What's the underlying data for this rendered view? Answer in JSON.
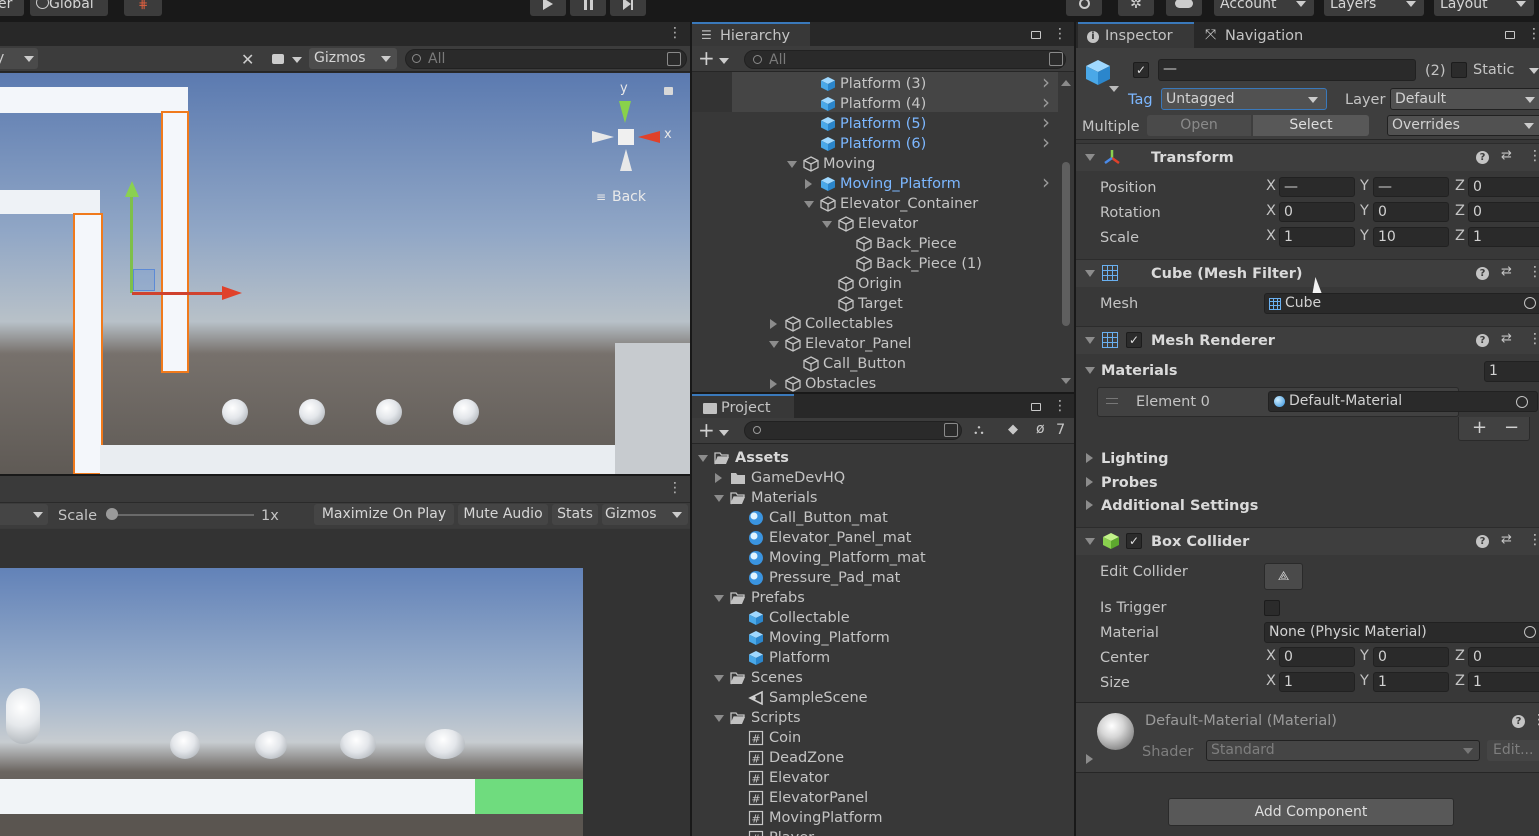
{
  "toolbar": {
    "left_label": "er",
    "global_label": "Global",
    "account": "Account",
    "layers": "Layers",
    "layout": "Layout"
  },
  "scene": {
    "gizmos": "Gizmos",
    "search_placeholder": "All",
    "back_label": "Back",
    "axis_y": "y",
    "axis_x": "x"
  },
  "game": {
    "scale_label": "Scale",
    "scale_value": "1x",
    "maximize": "Maximize On Play",
    "mute": "Mute Audio",
    "stats": "Stats",
    "gizmos": "Gizmos",
    "scale_fraction": 0.0
  },
  "hierarchy": {
    "title": "Hierarchy",
    "search_placeholder": "All",
    "items": [
      {
        "label": "Platform (3)"
      },
      {
        "label": "Platform (4)"
      },
      {
        "label": "Platform (5)"
      },
      {
        "label": "Platform (6)"
      },
      {
        "label": "Moving"
      },
      {
        "label": "Moving_Platform"
      },
      {
        "label": "Elevator_Container"
      },
      {
        "label": "Elevator"
      },
      {
        "label": "Back_Piece"
      },
      {
        "label": "Back_Piece (1)"
      },
      {
        "label": "Origin"
      },
      {
        "label": "Target"
      },
      {
        "label": "Collectables"
      },
      {
        "label": "Elevator_Panel"
      },
      {
        "label": "Call_Button"
      },
      {
        "label": "Obstacles"
      }
    ]
  },
  "project": {
    "title": "Project",
    "hidden_count": "7",
    "items": [
      {
        "label": "Assets"
      },
      {
        "label": "GameDevHQ"
      },
      {
        "label": "Materials"
      },
      {
        "label": "Call_Button_mat"
      },
      {
        "label": "Elevator_Panel_mat"
      },
      {
        "label": "Moving_Platform_mat"
      },
      {
        "label": "Pressure_Pad_mat"
      },
      {
        "label": "Prefabs"
      },
      {
        "label": "Collectable"
      },
      {
        "label": "Moving_Platform"
      },
      {
        "label": "Platform"
      },
      {
        "label": "Scenes"
      },
      {
        "label": "SampleScene"
      },
      {
        "label": "Scripts"
      },
      {
        "label": "Coin"
      },
      {
        "label": "DeadZone"
      },
      {
        "label": "Elevator"
      },
      {
        "label": "ElevatorPanel"
      },
      {
        "label": "MovingPlatform"
      },
      {
        "label": "Player"
      }
    ]
  },
  "inspector": {
    "tab_inspector": "Inspector",
    "tab_navigation": "Navigation",
    "name_value": "—",
    "count": "(2)",
    "static_label": "Static",
    "tag_label": "Tag",
    "tag_value": "Untagged",
    "layer_label": "Layer",
    "layer_value": "Default",
    "multiple_label": "Multiple",
    "open": "Open",
    "select": "Select",
    "overrides": "Overrides",
    "transform": {
      "title": "Transform",
      "position_label": "Position",
      "rotation_label": "Rotation",
      "scale_label": "Scale",
      "x": "X",
      "y": "Y",
      "z": "Z",
      "position": [
        "—",
        "—",
        "0"
      ],
      "rotation": [
        "0",
        "0",
        "0"
      ],
      "scale": [
        "1",
        "10",
        "1"
      ]
    },
    "mesh_filter": {
      "title": "Cube (Mesh Filter)",
      "mesh_label": "Mesh",
      "mesh_value": "Cube"
    },
    "mesh_renderer": {
      "title": "Mesh Renderer",
      "materials_label": "Materials",
      "materials_count": "1",
      "element_label": "Element 0",
      "element_value": "Default-Material",
      "lighting": "Lighting",
      "probes": "Probes",
      "additional": "Additional Settings"
    },
    "box_collider": {
      "title": "Box Collider",
      "edit_collider": "Edit Collider",
      "is_trigger": "Is Trigger",
      "material_label": "Material",
      "material_value": "None (Physic Material)",
      "center_label": "Center",
      "size_label": "Size",
      "center": [
        "0",
        "0",
        "0"
      ],
      "size": [
        "1",
        "1",
        "1"
      ]
    },
    "material": {
      "title": "Default-Material (Material)",
      "shader_label": "Shader",
      "shader_value": "Standard",
      "edit": "Edit..."
    },
    "add_component": "Add Component"
  },
  "colors": {
    "selection_blue": "#7cb7ff",
    "panel_bg": "#383838",
    "header_bg": "#3e3e3e"
  }
}
